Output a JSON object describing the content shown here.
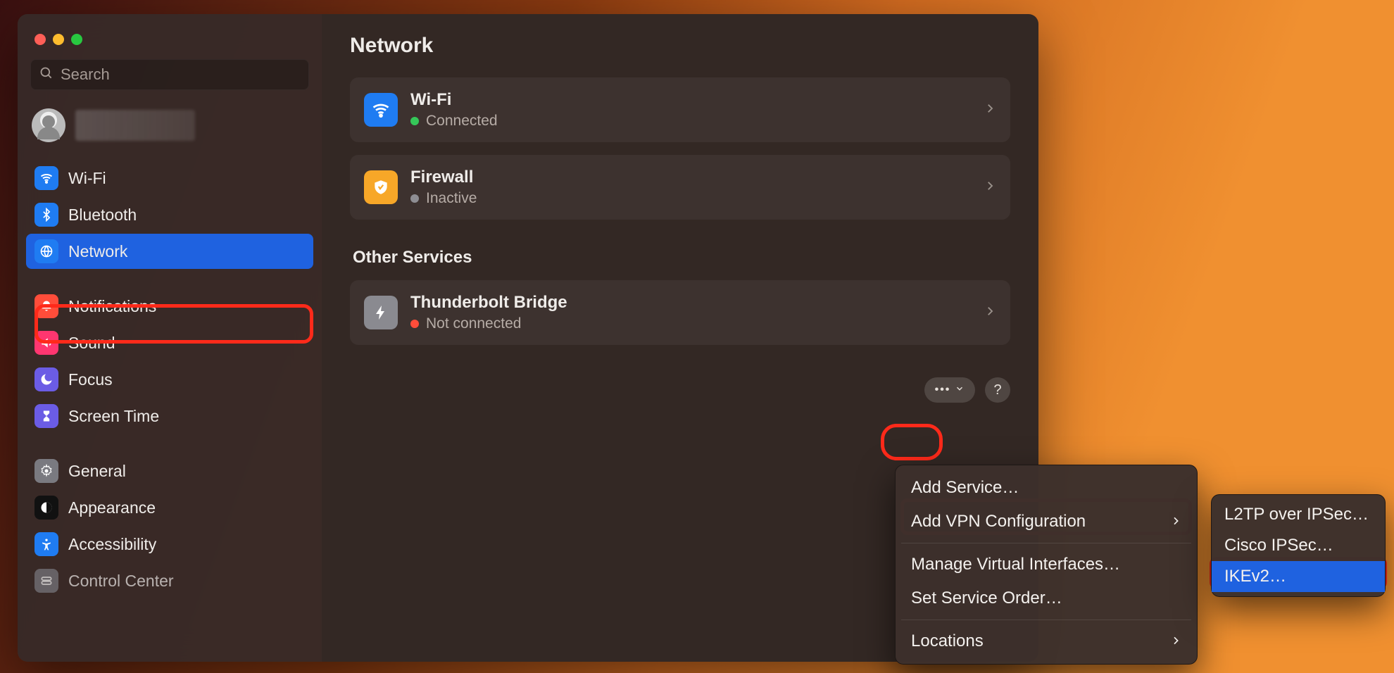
{
  "search": {
    "placeholder": "Search"
  },
  "sidebar": {
    "items": [
      {
        "label": "Wi-Fi"
      },
      {
        "label": "Bluetooth"
      },
      {
        "label": "Network"
      },
      {
        "label": "Notifications"
      },
      {
        "label": "Sound"
      },
      {
        "label": "Focus"
      },
      {
        "label": "Screen Time"
      },
      {
        "label": "General"
      },
      {
        "label": "Appearance"
      },
      {
        "label": "Accessibility"
      },
      {
        "label": "Control Center"
      }
    ]
  },
  "page": {
    "title": "Network",
    "section_other": "Other Services"
  },
  "services": {
    "wifi": {
      "title": "Wi-Fi",
      "status": "Connected"
    },
    "firewall": {
      "title": "Firewall",
      "status": "Inactive"
    },
    "thunderbolt": {
      "title": "Thunderbolt Bridge",
      "status": "Not connected"
    }
  },
  "menu": {
    "add_service": "Add Service…",
    "add_vpn": "Add VPN Configuration",
    "manage_vi": "Manage Virtual Interfaces…",
    "set_order": "Set Service Order…",
    "locations": "Locations"
  },
  "vpn_submenu": {
    "l2tp": "L2TP over IPSec…",
    "cisco": "Cisco IPSec…",
    "ikev2": "IKEv2…"
  },
  "colors": {
    "green": "#35c759",
    "gray": "#8e8e93",
    "orange": "#ff4d3a"
  }
}
